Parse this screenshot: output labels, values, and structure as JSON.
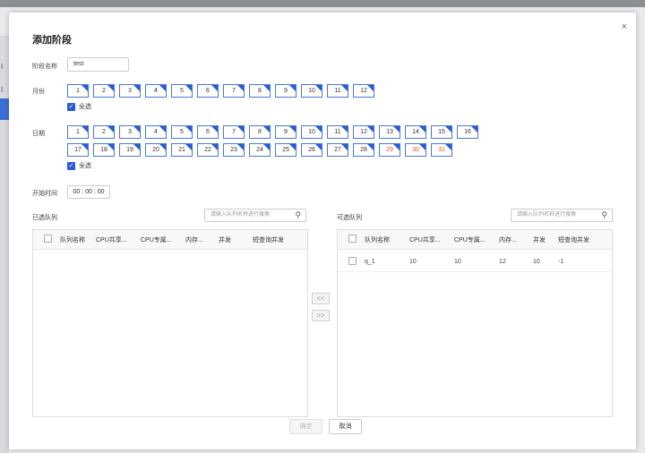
{
  "background": {
    "left_letters": [
      "I",
      "I"
    ]
  },
  "dialog": {
    "title": "添加阶段",
    "close_glyph": "×",
    "stage_name_label": "阶段名称",
    "stage_name_value": "test",
    "month_label": "月份",
    "months": [
      "1",
      "2",
      "3",
      "4",
      "5",
      "6",
      "7",
      "8",
      "9",
      "10",
      "11",
      "12"
    ],
    "month_select_all": "全选",
    "date_label": "日期",
    "dates_row1": [
      "1",
      "2",
      "3",
      "4",
      "5",
      "6",
      "7",
      "8",
      "9",
      "10",
      "11",
      "12",
      "13",
      "14",
      "15",
      "16"
    ],
    "dates_row2": [
      "17",
      "18",
      "19",
      "20",
      "21",
      "22",
      "23",
      "24",
      "25",
      "26",
      "27",
      "28",
      "29",
      "30",
      "31"
    ],
    "date_select_all": "全选",
    "start_time_label": "开始时间",
    "start_time_value": "00 : 00 : 00",
    "selected_panel": {
      "title": "已选队列",
      "search_placeholder": "请输入队列名称进行搜索",
      "columns": [
        "队列名称",
        "CPU共享...",
        "CPU专属...",
        "内存...",
        "并发",
        "短查询并发"
      ],
      "rows": []
    },
    "available_panel": {
      "title": "可选队列",
      "search_placeholder": "请输入队列名称进行搜索",
      "columns": [
        "队列名称",
        "CPU共享...",
        "CPU专属...",
        "内存...",
        "并发",
        "短查询并发"
      ],
      "rows": [
        [
          "q_1",
          "10",
          "10",
          "12",
          "10",
          "-1"
        ]
      ]
    },
    "move_left_label": "<<",
    "move_right_label": ">>",
    "confirm_label": "确定",
    "cancel_label": "取消"
  },
  "colors": {
    "accent": "#2a5bd7",
    "weekend_red": "#e5533c"
  }
}
